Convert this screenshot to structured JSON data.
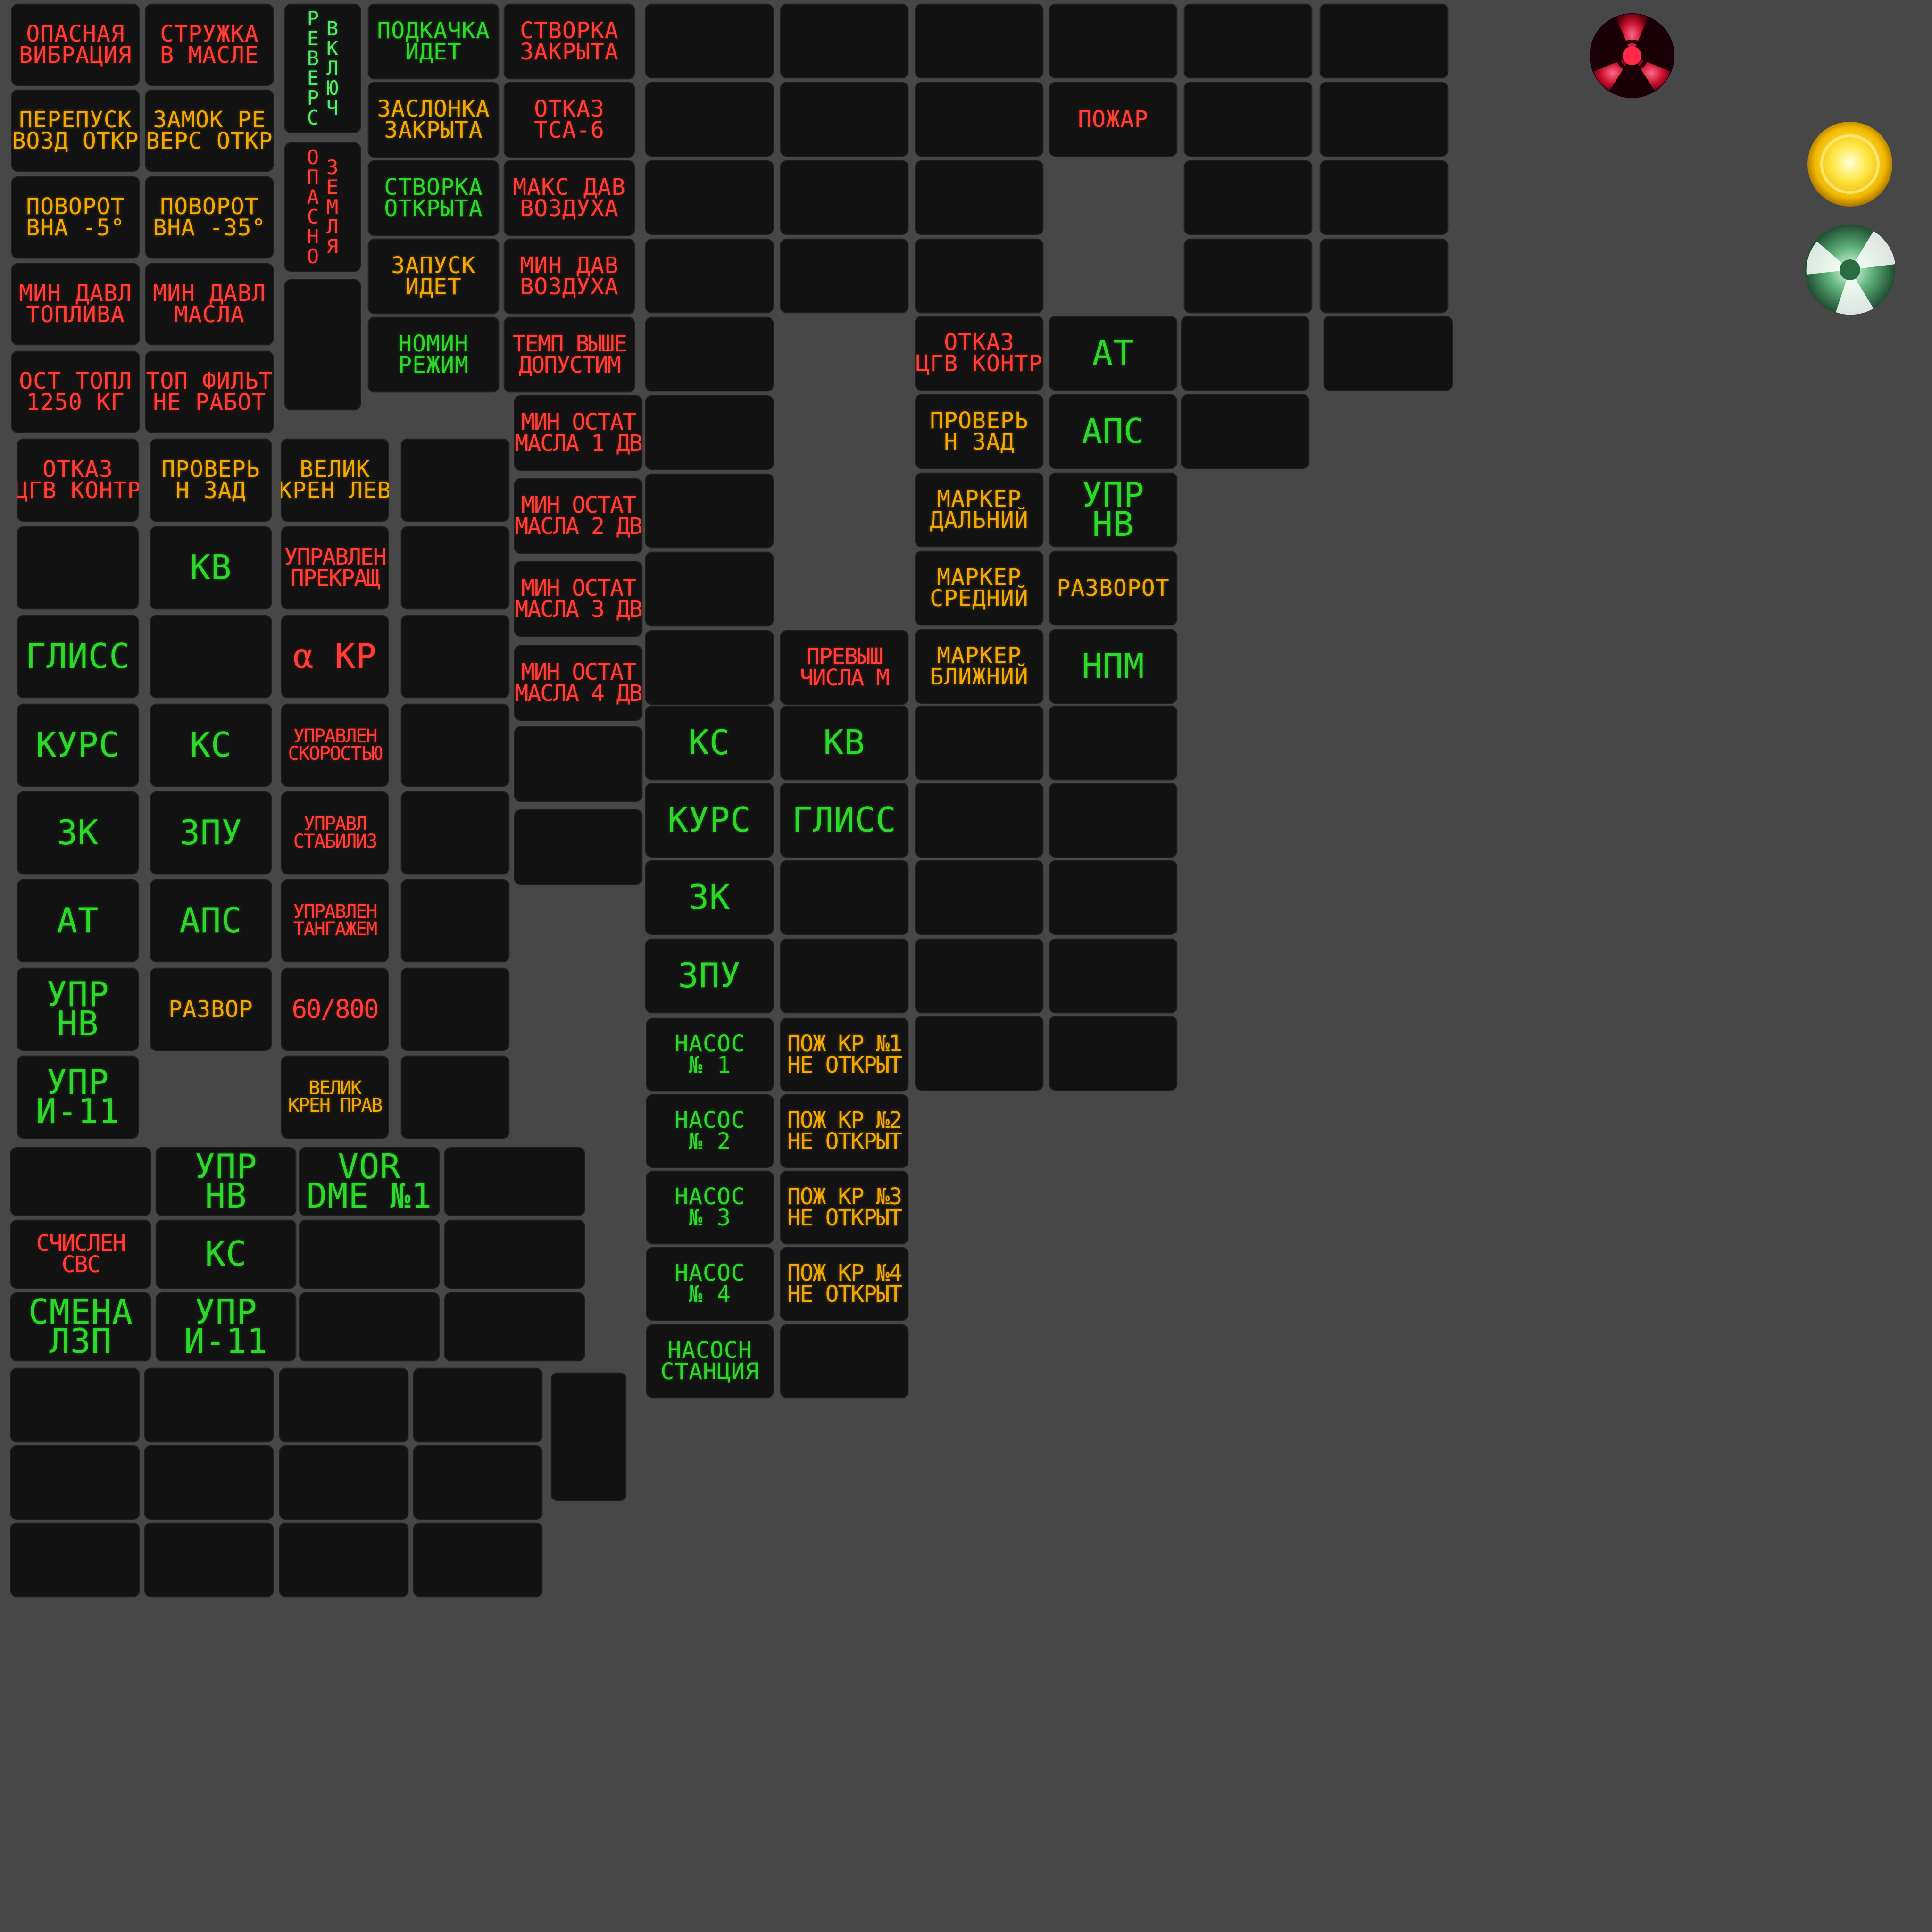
{
  "colors": {
    "background": "#474747",
    "tile": "#121212",
    "red": "#ff3e36",
    "amber": "#f2a800",
    "green": "#2ed82a",
    "light_green": "#58e868"
  },
  "cells": {
    "c01": "ОПАСНАЯ\nВИБРАЦИЯ",
    "c02": "СТРУЖКА\nВ МАСЛЕ",
    "c03": "ПЕРЕПУСК\nВОЗД ОТКР",
    "c04": "ЗАМОК РЕ\nВЕРС ОТКР",
    "c05": "ПОВОРОТ\nВНА -5°",
    "c06": "ПОВОРОТ\nВНА -35°",
    "c07": "МИН ДАВЛ\nТОПЛИВА",
    "c08": "МИН ДАВЛ\nМАСЛА",
    "c09": "ОСТ ТОПЛ\n1250 КГ",
    "c10": "ТОП ФИЛЬТ\nНЕ РАБОТ",
    "c11": "ПОДКАЧКА\nИДЕТ",
    "c12": "СТВОРКА\nЗАКРЫТА",
    "c13": "ЗАСЛОНКА\nЗАКРЫТА",
    "c14": "ОТКАЗ\nТСА-6",
    "c15": "СТВОРКА\nОТКРЫТА",
    "c16": "МАКС ДАВ\nВОЗДУХА",
    "c17": "ЗАПУСК\nИДЕТ",
    "c18": "МИН ДАВ\nВОЗДУХА",
    "c19": "НОМИН\nРЕЖИМ",
    "c20": "ТЕМП ВЫШЕ\nДОПУСТИМ",
    "c21": "МИН ОСТАТ\nМАСЛА 1 ДВ",
    "c22": "МИН ОСТАТ\nМАСЛА 2 ДВ",
    "c23": "МИН ОСТАТ\nМАСЛА 3 ДВ",
    "c24": "МИН ОСТАТ\nМАСЛА 4 ДВ",
    "c25": "ОТКАЗ\nЦГВ КОНТР",
    "c26": "ПРОВЕРЬ\nН ЗАД",
    "c27": "ВЕЛИК\nКРЕН ЛЕВ",
    "c28": "КВ",
    "c29": "УПРАВЛЕН\nПРЕКРАЩ",
    "c30": "ГЛИСС",
    "c31": "α КР",
    "c32": "КУРС",
    "c33": "КС",
    "c34": "УПРАВЛЕН\nСКОРОСТЬЮ",
    "c35": "ЗК",
    "c36": "ЗПУ",
    "c37": "УПРАВЛ\nСТАБИЛИЗ",
    "c38": "АТ",
    "c39": "АПС",
    "c40": "УПРАВЛЕН\nТАНГАЖЕМ",
    "c41": "УПР\nНВ",
    "c42": "РАЗВОР",
    "c43": "60/800",
    "c44": "УПР\nИ-11",
    "c45": "ВЕЛИК\nКРЕН ПРАВ",
    "c46": "УПР\nНВ",
    "c47": "VOR\nDME №1",
    "c48": "СЧИСЛЕН\nСВС",
    "c49": "КС",
    "c50": "СМЕНА\nЛЗП",
    "c51": "УПР\nИ-11",
    "c52": "ПРЕВЫШ\nЧИСЛА М",
    "c53": "КС",
    "c54": "КВ",
    "c55": "КУРС",
    "c56": "ГЛИСС",
    "c57": "ЗК",
    "c58": "ЗПУ",
    "c59": "НАСОС\n№ 1",
    "c60": "ПОЖ КР №1\nНЕ ОТКРЫТ",
    "c61": "НАСОС\n№ 2",
    "c62": "ПОЖ КР №2\nНЕ ОТКРЫТ",
    "c63": "НАСОС\n№ 3",
    "c64": "ПОЖ КР №3\nНЕ ОТКРЫТ",
    "c65": "НАСОС\n№ 4",
    "c66": "ПОЖ КР №4\nНЕ ОТКРЫТ",
    "c67": "НАСОСН\nСТАНЦИЯ",
    "c68": "ПОЖАР",
    "c69": "ОТКАЗ\nЦГВ КОНТР",
    "c70": "АТ",
    "c71": "ПРОВЕРЬ\nН ЗАД",
    "c72": "АПС",
    "c73": "МАРКЕР\nДАЛЬНИЙ",
    "c74": "УПР\nНВ",
    "c75": "МАРКЕР\nСРЕДНИЙ",
    "c76": "РАЗВОРОТ",
    "c77": "МАРКЕР\nБЛИЖНИЙ",
    "c78": "НПМ"
  },
  "vertical": {
    "reverse_col1": "Р\nЕ\nВ\nЕ\nР\nС",
    "reverse_col2": "В\nК\nЛ\nЮ\nЧ",
    "ground_col1": "О\nП\nА\nС\nН\nО",
    "ground_col2": "З\nЕ\nМ\nЛ\nЯ"
  },
  "lamps": {
    "radiation_icon": "radiation-icon",
    "amber_lamp": "amber-lamp",
    "green_lamp": "green-lamp"
  }
}
